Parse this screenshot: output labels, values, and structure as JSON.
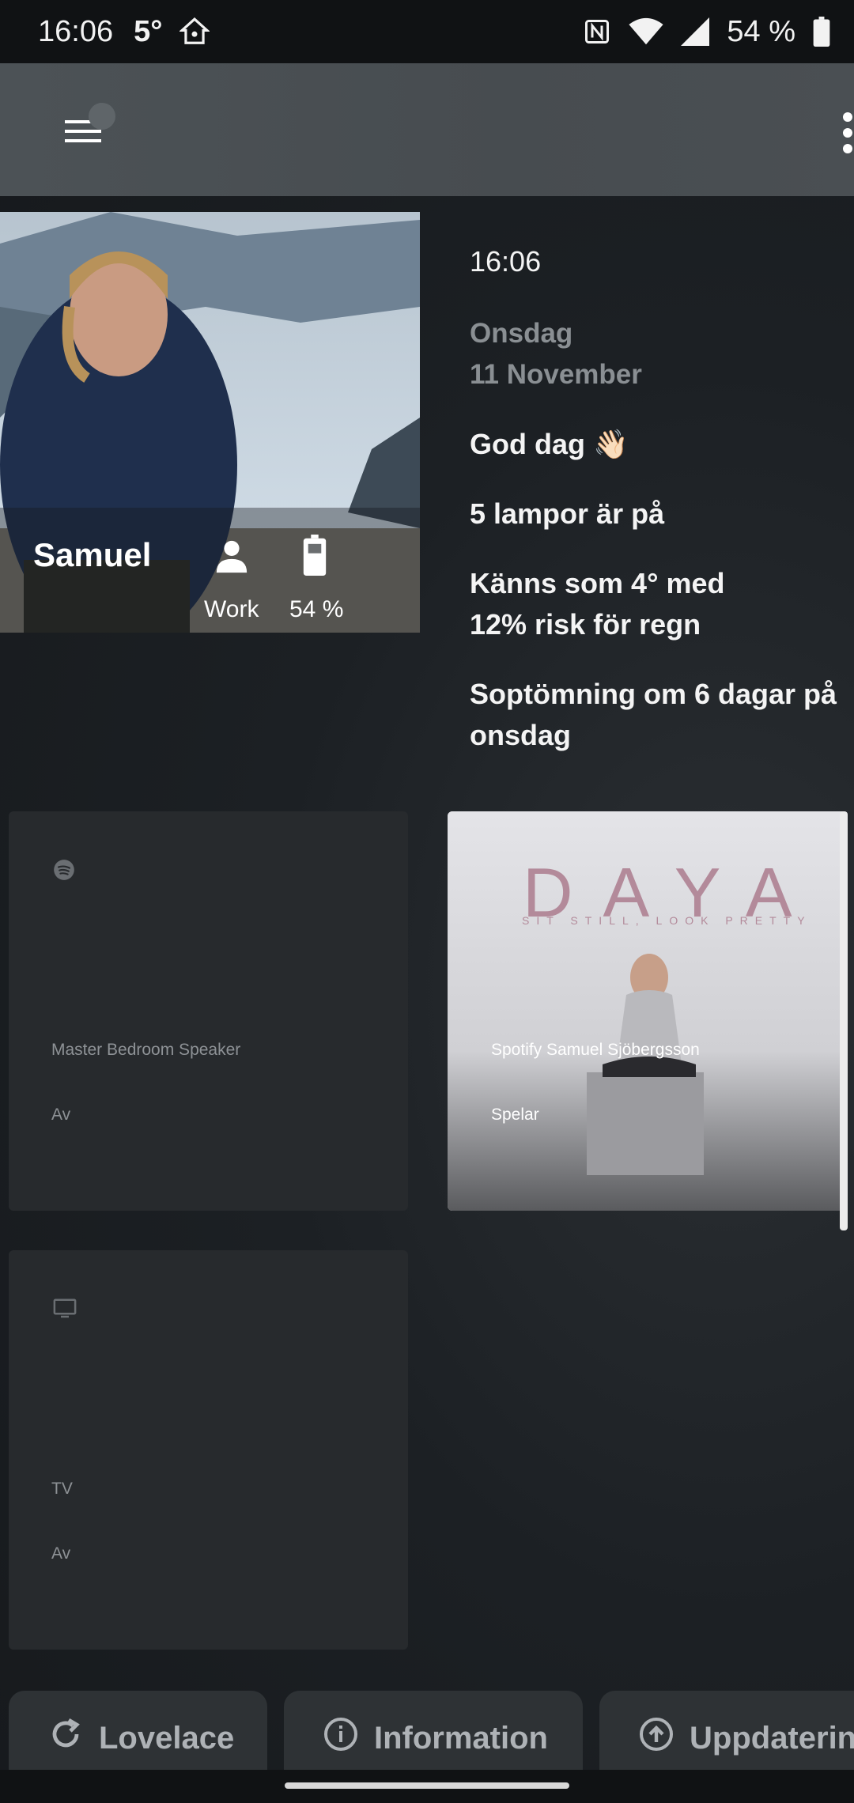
{
  "status_bar": {
    "time": "16:06",
    "temperature": "5°",
    "battery": "54 %"
  },
  "person": {
    "name": "Samuel",
    "zone": "Work",
    "battery": "54 %"
  },
  "info_panel": {
    "clock": "16:06",
    "weekday": "Onsdag",
    "date": "11 November",
    "greeting": "God dag 👋🏻",
    "lights": "5 lampor är på",
    "weather_line1": "Känns som 4° med",
    "weather_line2": "12% risk för regn",
    "trash_line1": "Soptömning om 6 dagar på",
    "trash_line2": "onsdag"
  },
  "media": {
    "bedroom": {
      "name": "Master Bedroom Speaker",
      "state": "Av",
      "icon": "spotify-icon"
    },
    "spotify": {
      "name": "Spotify Samuel Sjöbergsson",
      "state": "Spelar",
      "album_title": "DAYA",
      "album_subtitle": "SIT STILL, LOOK PRETTY"
    },
    "tv": {
      "name": "TV",
      "state": "Av",
      "icon": "tv-icon"
    }
  },
  "tabs": [
    {
      "label": "Lovelace",
      "icon": "refresh-icon"
    },
    {
      "label": "Information",
      "icon": "info-icon"
    },
    {
      "label": "Uppdatering",
      "icon": "upload-icon"
    }
  ],
  "colors": {
    "header": "#4c5256",
    "card": "#272a2d",
    "muted_text": "#8a8f93"
  }
}
